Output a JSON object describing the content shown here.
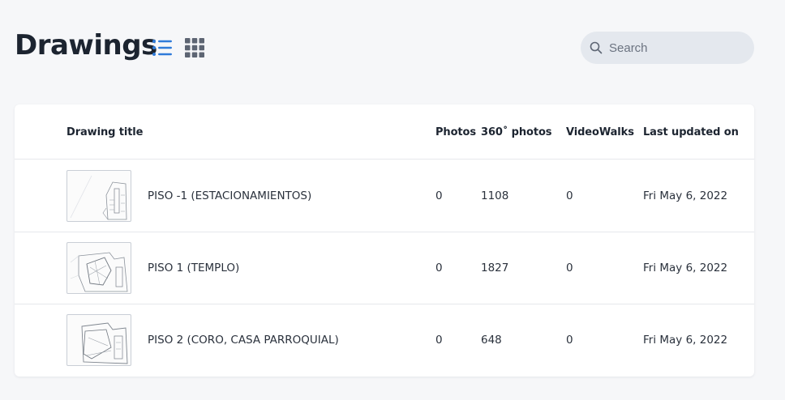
{
  "page": {
    "title": "Drawings"
  },
  "view_toggle": {
    "list_icon": "list-icon",
    "grid_icon": "grid-icon",
    "active": "list",
    "active_color": "#2f7bd9",
    "inactive_color": "#5d6573"
  },
  "search": {
    "placeholder": "Search",
    "value": "",
    "icon": "search-icon"
  },
  "table": {
    "columns": {
      "title": "Drawing title",
      "photos": "Photos",
      "photos360": "360˚ photos",
      "videowalks": "VideoWalks",
      "updated": "Last updated on"
    },
    "rows": [
      {
        "title": "PISO -1 (ESTACIONAMIENTOS)",
        "photos": "0",
        "photos360": "1108",
        "videowalks": "0",
        "updated": "Fri May 6, 2022"
      },
      {
        "title": "PISO 1 (TEMPLO)",
        "photos": "0",
        "photos360": "1827",
        "videowalks": "0",
        "updated": "Fri May 6, 2022"
      },
      {
        "title": "PISO 2 (CORO, CASA PARROQUIAL)",
        "photos": "0",
        "photos360": "648",
        "videowalks": "0",
        "updated": "Fri May 6, 2022"
      }
    ]
  }
}
